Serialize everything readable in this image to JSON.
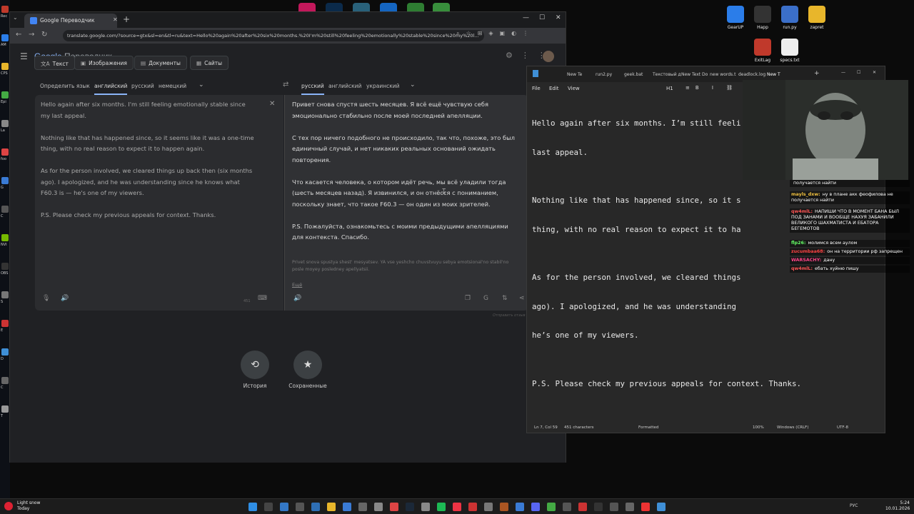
{
  "desktop": {
    "left_labels": [
      "Rec",
      "AM",
      "CPS",
      "Epi",
      "La",
      "foo",
      "G",
      "C",
      "NVI",
      "OBS",
      "S",
      "E",
      "D",
      "C",
      "T"
    ],
    "right_icons": [
      {
        "label": "GearUP",
        "color": "#2b7de9"
      },
      {
        "label": "Happ",
        "color": "#333333"
      },
      {
        "label": "run.py",
        "color": "#3b6fc9"
      },
      {
        "label": "zapret",
        "color": "#e8b62b"
      },
      {
        "label": "ExitLag",
        "color": "#c0392b"
      },
      {
        "label": "specs.txt",
        "color": "#eeeeee"
      }
    ]
  },
  "browser": {
    "tab_title": "Google Переводчик",
    "url": "translate.google.com/?source=gtx&sl=en&tl=ru&text=Hello%20again%20after%20six%20months.%20I'm%20still%20feeling%20emotionally%20stable%20since%20my%20l..."
  },
  "translate": {
    "brand_google": "Google",
    "brand_product": "Переводчик",
    "modes": [
      {
        "icon": "文A",
        "label": "Текст"
      },
      {
        "icon": "▣",
        "label": "Изображения"
      },
      {
        "icon": "▤",
        "label": "Документы"
      },
      {
        "icon": "▦",
        "label": "Сайты"
      }
    ],
    "source_langs": [
      "Определить язык",
      "английский",
      "русский",
      "немецкий"
    ],
    "target_langs": [
      "русский",
      "английский",
      "украинский"
    ],
    "source_paragraphs": [
      "Hello again after six months. I'm still feeling emotionally stable since my last appeal.",
      "Nothing like that has happened since, so it seems like it was a one-time thing, with no real reason to expect it to happen again.",
      "As for the person involved, we cleared things up back then (six months ago). I apologized, and he was understanding since he knows what F60.3 is — he's one of my viewers.",
      "P.S. Please check my previous appeals for context. Thanks."
    ],
    "char_count": "451",
    "target_paragraphs": [
      "Привет снова спустя шесть месяцев. Я всё ещё чувствую себя эмоционально стабильно после моей последней апелляции.",
      "С тех пор ничего подобного не происходило, так что, похоже, это был единичный случай, и нет никаких реальных оснований ожидать повторения.",
      "Что касается человека, о котором идёт речь, мы всё уладили тогда (шесть месяцев назад). Я извинился, и он отнёсся с пониманием, поскольку знает, что такое F60.3 — он один из моих зрителей.",
      "P.S. Пожалуйста, ознакомьтесь с моими предыдущими апелляциями для контекста. Спасибо."
    ],
    "transliteration": "Privet snova spustya shest' mesyatsev. YA vse yeshcho chuvstvuyu sebya emotsional'no stabil'no posle moyey posledney apellyatsii.",
    "more_link": "Ещё",
    "feedback": "Отправить отзыв",
    "history_label": "История",
    "saved_label": "Сохраненные"
  },
  "notepad": {
    "tabs": [
      "New Te",
      "run2.py",
      "geek.bat",
      "Текстовый д",
      "New Text Do",
      "new words.t",
      "deadlock.log",
      "New T"
    ],
    "menu": [
      "File",
      "Edit",
      "View"
    ],
    "heading_level": "H1",
    "lines": [
      "Hello again after six months. I’m still feeli",
      "last appeal.",
      "",
      "Nothing like that has happened since, so it s",
      "thing, with no real reason to expect it to ha",
      "",
      "As for the person involved, we cleared things",
      "ago). I apologized, and he was understanding ",
      "he’s one of my viewers.",
      "",
      "P.S. Please check my previous appeals for context. Thanks."
    ],
    "status": {
      "position": "Ln 7, Col 59",
      "chars": "451 characters",
      "format": "Formatted",
      "zoom": "100%",
      "line_ending": "Windows (CRLF)",
      "encoding": "UTF-8"
    }
  },
  "chat": [
    {
      "user": "",
      "text": "получается найти",
      "color": "#ffffff"
    },
    {
      "user": "mayls_dxw:",
      "text": "ну в плане акк феофилова не получается найти",
      "color": "#f0c040"
    },
    {
      "user": "qw4mlL:",
      "text": "НАПИШИ ЧТО В МОМЕНТ БАНА БЫЛ ПОД ЗАНАМИ И ВООБЩЕ НАХУЯ ЗАБАНИЛИ ВЕЛИКОГО ШАХМАТИСТА И ЕБАТОРА БЕГЕМОТОВ",
      "color": "#ff5555"
    },
    {
      "user": "flp26:",
      "text": "молимся всем аулом",
      "color": "#66ff66"
    },
    {
      "user": "zucumbaa68:",
      "text": "он на территории рф запрещен",
      "color": "#ff4444"
    },
    {
      "user": "WARSACHY:",
      "text": "дану",
      "color": "#ff4488"
    },
    {
      "user": "qw4mlL:",
      "text": "ебать хуйню пишу",
      "color": "#ff5555"
    }
  ],
  "taskbar": {
    "weather_line1": "Light snow",
    "weather_line2": "Today",
    "lang": "РУС",
    "time": "5:24",
    "date": "10.01.2026"
  }
}
